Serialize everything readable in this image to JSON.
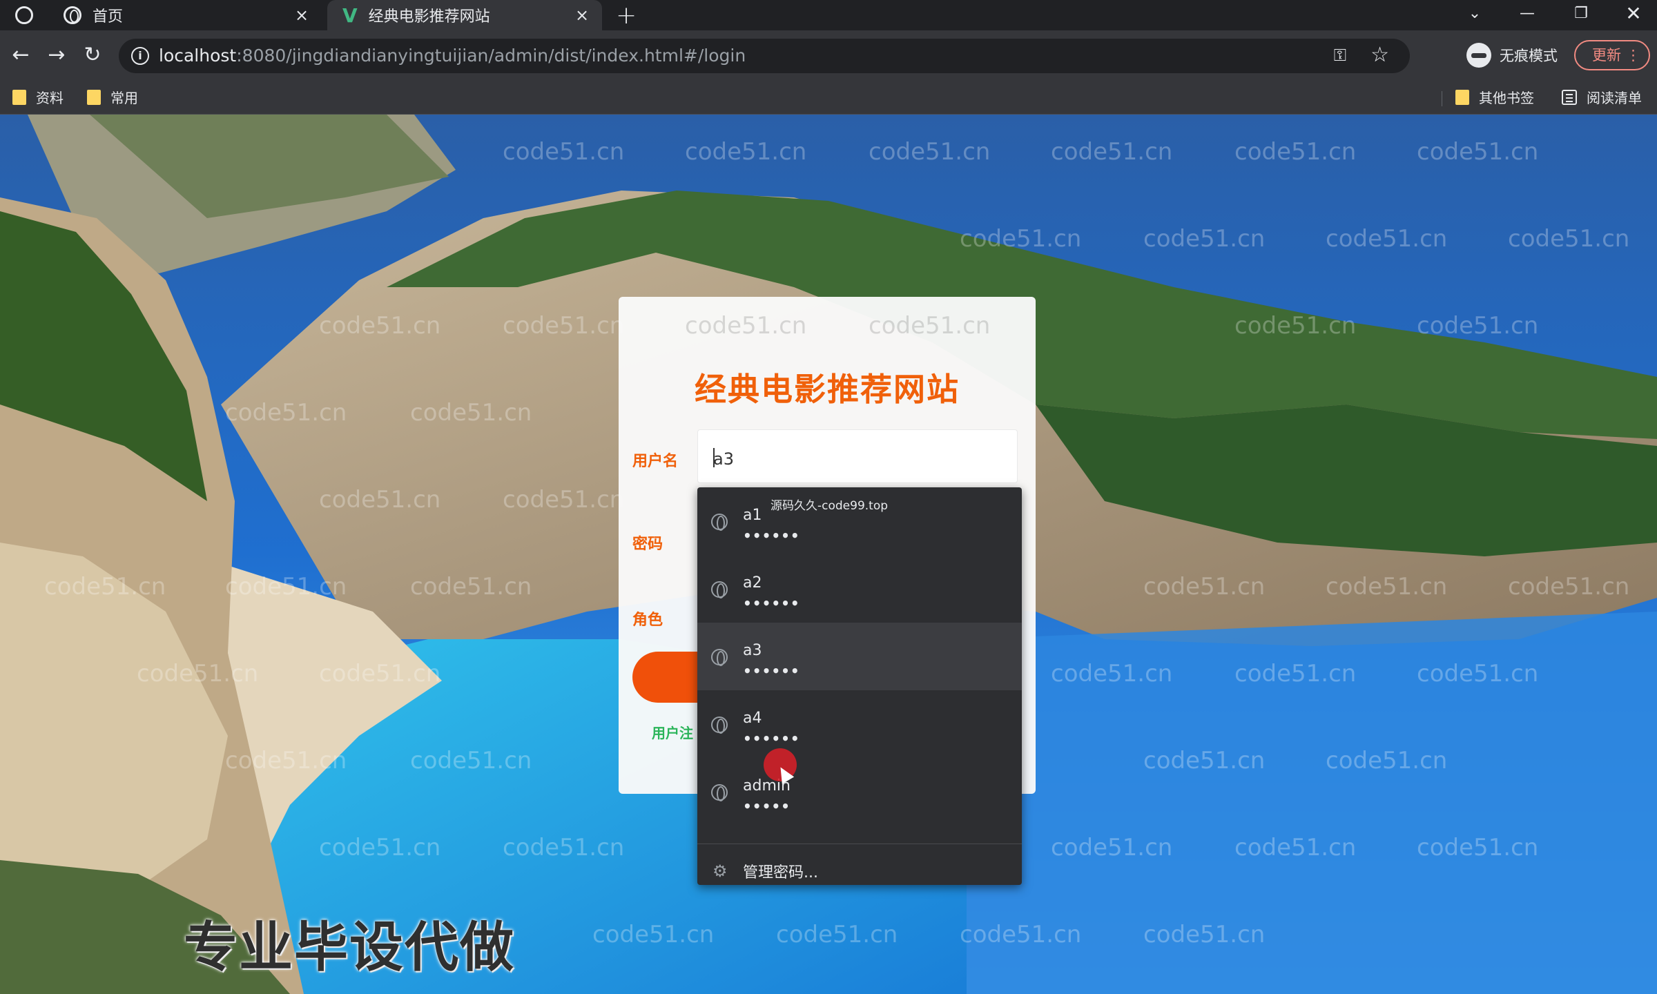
{
  "browser": {
    "tabs": [
      {
        "label": "首页",
        "active": false
      },
      {
        "label": "经典电影推荐网站",
        "active": true
      }
    ],
    "url_host": "localhost",
    "url_rest": ":8080/jingdiandianyingtuijian/admin/dist/index.html#/login",
    "incognito_label": "无痕模式",
    "update_label": "更新",
    "bookmarks": [
      {
        "label": "资料"
      },
      {
        "label": "常用"
      }
    ],
    "other_bookmarks_label": "其他书签",
    "reading_list_label": "阅读清单"
  },
  "login": {
    "title": "经典电影推荐网站",
    "username_label": "用户名",
    "username_value": "a3",
    "password_label": "密码",
    "role_label": "角色",
    "register_link": "用户注"
  },
  "autofill": {
    "source_label": "源码久久-code99.top",
    "items": [
      {
        "user": "a1",
        "masked": "••••••"
      },
      {
        "user": "a2",
        "masked": "••••••"
      },
      {
        "user": "a3",
        "masked": "••••••"
      },
      {
        "user": "a4",
        "masked": "••••••"
      },
      {
        "user": "admin",
        "masked": "•••••"
      }
    ],
    "manage_label": "管理密码..."
  },
  "watermark_text": "code51.cn",
  "caption": "专业毕设代做",
  "colors": {
    "title_orange": "#f0600a",
    "button_orange": "#f0500a",
    "register_green": "#2bb55a",
    "cursor_red": "#dc1e28"
  }
}
